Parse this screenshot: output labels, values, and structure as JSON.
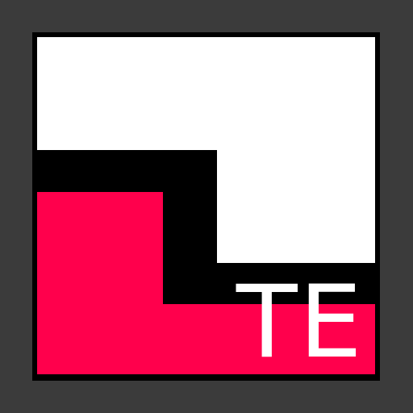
{
  "icon": {
    "logo_text": "TE"
  },
  "colors": {
    "background": "#3b3b3b",
    "frame": "#000000",
    "white_block": "#ffffff",
    "accent_red": "#ff004c",
    "text": "#ffffff"
  }
}
